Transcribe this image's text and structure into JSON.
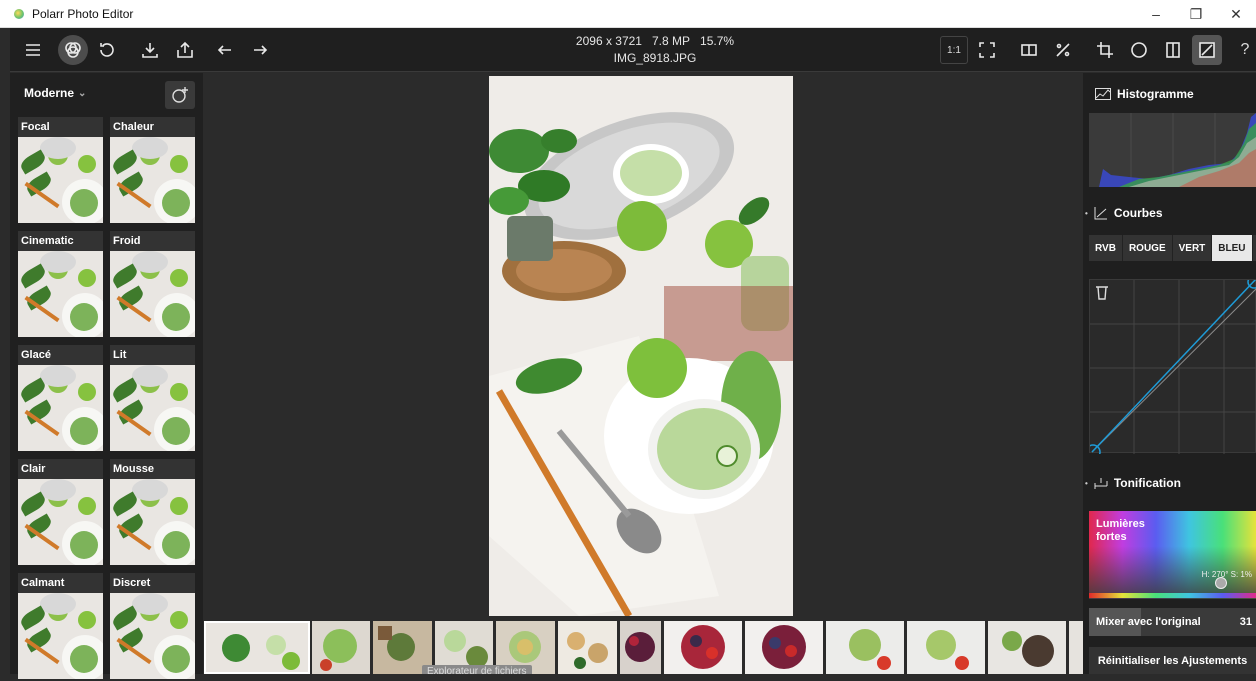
{
  "window": {
    "title": "Polarr Photo Editor",
    "controls": [
      "–",
      "❐",
      "✕"
    ]
  },
  "image_info": {
    "dimensions": "2096 x 3721",
    "megapixels": "7.8 MP",
    "zoom": "15.7%",
    "filename": "IMG_8918.JPG"
  },
  "toolbar": {
    "one_to_one": "1:1",
    "help": "?"
  },
  "filters": {
    "category": "Moderne",
    "items": [
      "Focal",
      "Chaleur",
      "Cinematic",
      "Froid",
      "Glacé",
      "Lit",
      "Clair",
      "Mousse",
      "Calmant",
      "Discret"
    ]
  },
  "right_panel": {
    "histogram_title": "Histogramme",
    "curves_title": "Courbes",
    "curve_tabs": [
      "RVB",
      "ROUGE",
      "VERT",
      "BLEU"
    ],
    "active_tab": "BLEU",
    "toning_title": "Tonification",
    "toning_region": "Lumières fortes",
    "hs_readout": "H: 270° S: 1%",
    "mix_label": "Mixer avec l'original",
    "mix_value": "31",
    "mix_fraction": 0.31,
    "reset_label": "Réinitialiser les Ajustements"
  },
  "filmstrip": {
    "tooltip": "Explorateur de fichiers"
  },
  "colors": {
    "accent": "#1e9bd7",
    "panel": "#1f1f1f",
    "background": "#2b2b2b"
  }
}
